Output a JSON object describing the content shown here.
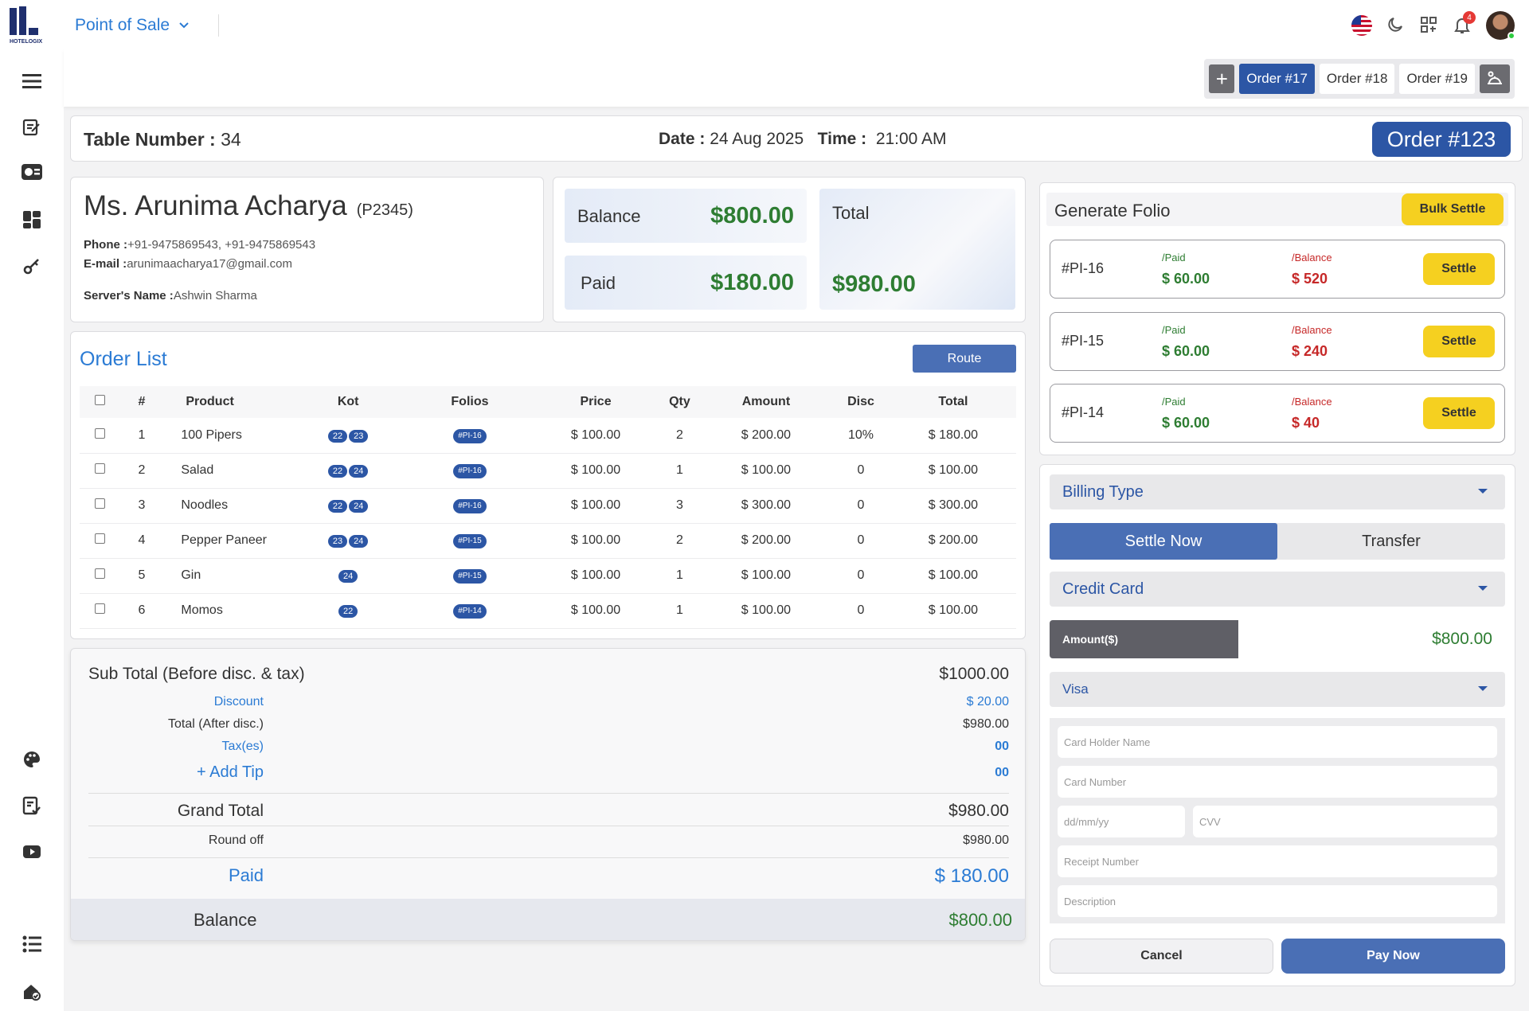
{
  "app": {
    "logo_text": "HOTELOGIX",
    "module": "Point of Sale",
    "notifications": "4"
  },
  "order_tabs": [
    "Order #17",
    "Order #18",
    "Order #19"
  ],
  "header": {
    "table_label": "Table Number :",
    "table_value": "34",
    "date_label": "Date :",
    "date_value": "24 Aug 2025",
    "time_label": "Time :",
    "time_value": "21:00 AM",
    "order_badge": "Order #123"
  },
  "guest": {
    "name": "Ms. Arunima Acharya",
    "code": "(P2345)",
    "phone_label": "Phone :",
    "phone": "+91-9475869543, +91-9475869543",
    "email_label": "E-mail :",
    "email": "arunimaacharya17@gmail.com",
    "server_label": "Server's Name :",
    "server": "Ashwin Sharma"
  },
  "totals": {
    "balance_label": "Balance",
    "balance": "$800.00",
    "paid_label": "Paid",
    "paid": "$180.00",
    "total_label": "Total",
    "total": "$980.00"
  },
  "order_list": {
    "title": "Order List",
    "route_btn": "Route",
    "columns": [
      "#",
      "Product",
      "Kot",
      "Folios",
      "Price",
      "Qty",
      "Amount",
      "Disc",
      "Total"
    ],
    "rows": [
      {
        "n": "1",
        "product": "100 Pipers",
        "kot": [
          "22",
          "23"
        ],
        "folio": "#PI-16",
        "price": "$ 100.00",
        "qty": "2",
        "amount": "$ 200.00",
        "disc": "10%",
        "total": "$ 180.00"
      },
      {
        "n": "2",
        "product": "Salad",
        "kot": [
          "22",
          "24"
        ],
        "folio": "#PI-16",
        "price": "$ 100.00",
        "qty": "1",
        "amount": "$ 100.00",
        "disc": "0",
        "total": "$ 100.00"
      },
      {
        "n": "3",
        "product": "Noodles",
        "kot": [
          "22",
          "24"
        ],
        "folio": "#PI-16",
        "price": "$ 100.00",
        "qty": "3",
        "amount": "$ 300.00",
        "disc": "0",
        "total": "$ 300.00"
      },
      {
        "n": "4",
        "product": "Pepper Paneer",
        "kot": [
          "23",
          "24"
        ],
        "folio": "#PI-15",
        "price": "$ 100.00",
        "qty": "2",
        "amount": "$ 200.00",
        "disc": "0",
        "total": "$ 200.00"
      },
      {
        "n": "5",
        "product": "Gin",
        "kot": [
          "24"
        ],
        "folio": "#PI-15",
        "price": "$ 100.00",
        "qty": "1",
        "amount": "$ 100.00",
        "disc": "0",
        "total": "$ 100.00"
      },
      {
        "n": "6",
        "product": "Momos",
        "kot": [
          "22"
        ],
        "folio": "#PI-14",
        "price": "$ 100.00",
        "qty": "1",
        "amount": "$ 100.00",
        "disc": "0",
        "total": "$ 100.00"
      }
    ]
  },
  "summary": {
    "subtotal_label": "Sub Total (Before disc. & tax)",
    "subtotal": "$1000.00",
    "discount_label": "Discount",
    "discount": "$ 20.00",
    "after_disc_label": "Total (After disc.)",
    "after_disc": "$980.00",
    "tax_label": "Tax(es)",
    "tax": "00",
    "tip_label": "+ Add Tip",
    "tip": "00",
    "grand_label": "Grand Total",
    "grand": "$980.00",
    "roundoff_label": "Round off",
    "roundoff": "$980.00",
    "paid_label": "Paid",
    "paid": "$ 180.00",
    "balance_label": "Balance",
    "balance": "$800.00"
  },
  "folio_panel": {
    "title": "Generate Folio",
    "bulk_btn": "Bulk Settle",
    "paid_label": "/Paid",
    "balance_label": "/Balance",
    "settle_label": "Settle",
    "folios": [
      {
        "id": "#PI-16",
        "paid": "$ 60.00",
        "balance": "$ 520"
      },
      {
        "id": "#PI-15",
        "paid": "$ 60.00",
        "balance": "$ 240"
      },
      {
        "id": "#PI-14",
        "paid": "$ 60.00",
        "balance": "$ 40"
      }
    ]
  },
  "payment": {
    "billing_type": "Billing Type",
    "settle_now": "Settle Now",
    "transfer": "Transfer",
    "method": "Credit Card",
    "amount_label": "Amount($)",
    "amount": "$800.00",
    "card_type": "Visa",
    "ph_holder": "Card Holder Name",
    "ph_number": "Card Number",
    "ph_date": "dd/mm/yy",
    "ph_cvv": "CVV",
    "ph_receipt": "Receipt Number",
    "ph_desc": "Description",
    "cancel": "Cancel",
    "pay_now": "Pay Now"
  },
  "colors": {
    "primary": "#2c56a5",
    "accent_blue": "#2b7bd4",
    "green": "#2e7d32",
    "red": "#c62828",
    "yellow": "#f5d020"
  }
}
